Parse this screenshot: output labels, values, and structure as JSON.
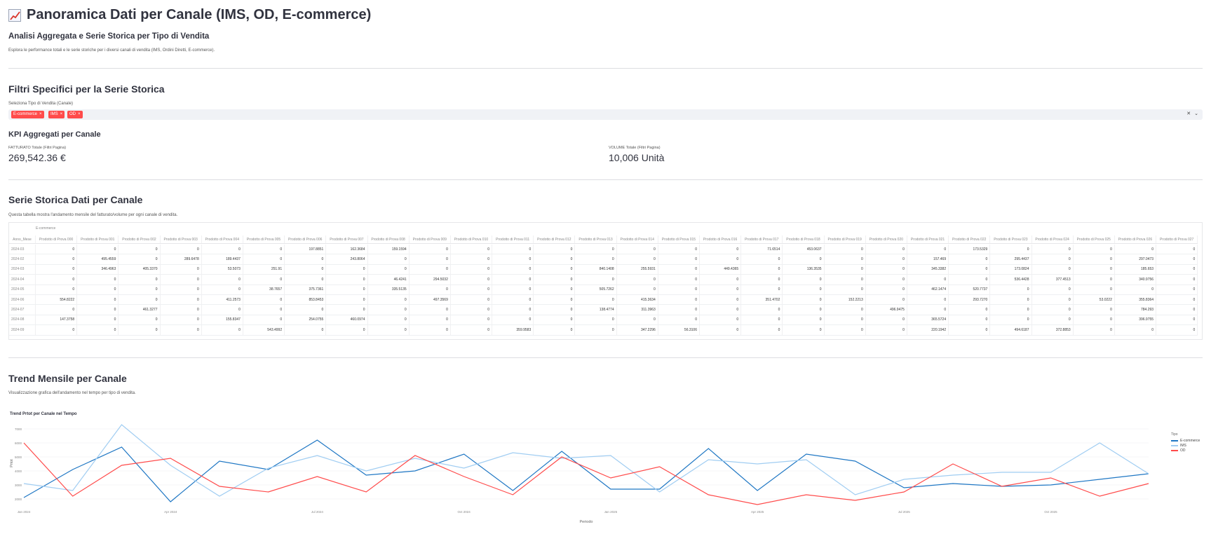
{
  "header": {
    "title": "Panoramica Dati per Canale (IMS, OD, E-commerce)",
    "subtitle": "Analisi Aggregata e Serie Storica per Tipo di Vendita",
    "caption": "Esplora le performance totali e le serie storiche per i diversi canali di vendita (IMS, Ordini Diretti, E-commerce)."
  },
  "filters": {
    "heading": "Filtri Specifici per la Serie Storica",
    "select_label": "Seleziona Tipo di Vendita (Canale)",
    "tags": [
      "E-commerce",
      "IMS",
      "OD"
    ],
    "tag_close_glyph": "×",
    "accent_color": "#ff4b4b"
  },
  "kpi": {
    "heading": "KPI Aggregati per Canale",
    "fatturato_label": "FATTURATO Totale (Filtri Pagina)",
    "fatturato_value": "269,542.36 €",
    "volume_label": "VOLUME Totale (Filtri Pagina)",
    "volume_value": "10,006 Unità"
  },
  "table_section": {
    "heading": "Serie Storica Dati per Canale",
    "caption": "Questa tabella mostra l'andamento mensile del fatturato/volume per ogni canale di vendita.",
    "group_label": "E-commerce",
    "index_header": "Anno_Mese",
    "columns": [
      "Prodotto di Prova 000",
      "Prodotto di Prova 001",
      "Prodotto di Prova 002",
      "Prodotto di Prova 003",
      "Prodotto di Prova 004",
      "Prodotto di Prova 005",
      "Prodotto di Prova 006",
      "Prodotto di Prova 007",
      "Prodotto di Prova 008",
      "Prodotto di Prova 009",
      "Prodotto di Prova 010",
      "Prodotto di Prova 011",
      "Prodotto di Prova 012",
      "Prodotto di Prova 013",
      "Prodotto di Prova 014",
      "Prodotto di Prova 015",
      "Prodotto di Prova 016",
      "Prodotto di Prova 017",
      "Prodotto di Prova 018",
      "Prodotto di Prova 019",
      "Prodotto di Prova 020",
      "Prodotto di Prova 021",
      "Prodotto di Prova 022",
      "Prodotto di Prova 023",
      "Prodotto di Prova 024",
      "Prodotto di Prova 025",
      "Prodotto di Prova 026",
      "Prodotto di Prova 027"
    ],
    "rows": [
      {
        "period": "2024-03",
        "values": [
          "0",
          "0",
          "0",
          "0",
          "0",
          "0",
          "197.8851",
          "162.3684",
          "159.1594",
          "0",
          "0",
          "0",
          "0",
          "0",
          "0",
          "0",
          "0",
          "71.6514",
          "453.0637",
          "0",
          "0",
          "0",
          "173.5329",
          "0",
          "0",
          "0",
          "0",
          "0"
        ]
      },
      {
        "period": "2024-02",
        "values": [
          "0",
          "495.4559",
          "0",
          "289.6478",
          "189.4437",
          "0",
          "0",
          "243.8064",
          "0",
          "0",
          "0",
          "0",
          "0",
          "0",
          "0",
          "0",
          "0",
          "0",
          "0",
          "0",
          "0",
          "157.469",
          "0",
          "295.4437",
          "0",
          "0",
          "297.0473",
          "0"
        ]
      },
      {
        "period": "2024-03",
        "values": [
          "0",
          "346.4963",
          "405.3370",
          "0",
          "53.5073",
          "251.91",
          "0",
          "0",
          "0",
          "0",
          "0",
          "0",
          "0",
          "840.1408",
          "255.5931",
          "0",
          "449.4365",
          "0",
          "136.3535",
          "0",
          "0",
          "345.3382",
          "0",
          "173.0824",
          "0",
          "0",
          "185.653",
          "0"
        ]
      },
      {
        "period": "2024-04",
        "values": [
          "0",
          "0",
          "0",
          "0",
          "0",
          "0",
          "0",
          "0",
          "46.4241",
          "294.5032",
          "0",
          "0",
          "0",
          "0",
          "0",
          "0",
          "0",
          "0",
          "0",
          "0",
          "0",
          "0",
          "0",
          "536.4428",
          "377.4513",
          "0",
          "340.9756",
          "0"
        ]
      },
      {
        "period": "2024-05",
        "values": [
          "0",
          "0",
          "0",
          "0",
          "0",
          "38.7657",
          "375.7361",
          "0",
          "335.5135",
          "0",
          "0",
          "0",
          "0",
          "505.7262",
          "0",
          "0",
          "0",
          "0",
          "0",
          "0",
          "0",
          "462.1474",
          "520.7737",
          "0",
          "0",
          "0",
          "0",
          "0"
        ]
      },
      {
        "period": "2024-06",
        "values": [
          "554.8222",
          "0",
          "0",
          "0",
          "411.2573",
          "0",
          "853.8453",
          "0",
          "0",
          "497.3569",
          "0",
          "0",
          "0",
          "0",
          "415.3634",
          "0",
          "0",
          "351.4702",
          "0",
          "152.2213",
          "0",
          "0",
          "293.7270",
          "0",
          "0",
          "53.0222",
          "355.8364",
          "0"
        ]
      },
      {
        "period": "2024-07",
        "values": [
          "0",
          "0",
          "461.3277",
          "0",
          "0",
          "0",
          "0",
          "0",
          "0",
          "0",
          "0",
          "0",
          "0",
          "138.4774",
          "311.3963",
          "0",
          "0",
          "0",
          "0",
          "0",
          "496.9475",
          "0",
          "0",
          "0",
          "0",
          "0",
          "784.293",
          "0"
        ]
      },
      {
        "period": "2024-08",
        "values": [
          "147.3758",
          "0",
          "0",
          "0",
          "155.8347",
          "0",
          "254.0755",
          "460.0974",
          "0",
          "0",
          "0",
          "0",
          "0",
          "0",
          "0",
          "0",
          "0",
          "0",
          "0",
          "0",
          "0",
          "365.5724",
          "0",
          "0",
          "0",
          "0",
          "396.9755",
          "0"
        ]
      },
      {
        "period": "2024-09",
        "values": [
          "0",
          "0",
          "0",
          "0",
          "0",
          "543.4992",
          "0",
          "0",
          "0",
          "0",
          "0",
          "359.9583",
          "0",
          "0",
          "347.2296",
          "56.3106",
          "0",
          "0",
          "0",
          "0",
          "0",
          "220.1942",
          "0",
          "494.6187",
          "372.8853",
          "0",
          "0",
          "0"
        ]
      }
    ]
  },
  "trend_section": {
    "heading": "Trend Mensile per Canale",
    "caption": "Visualizzazione grafica dell'andamento nel tempo per tipo di vendita."
  },
  "chart_data": {
    "type": "line",
    "title": "Trend Prtot per Canale nel Tempo",
    "xlabel": "Periodo",
    "ylabel": "Prtot",
    "legend_title": "Tipo",
    "legend_position": "top-right",
    "grid": true,
    "ylim": [
      1500,
      7600
    ],
    "yticks": [
      2000,
      3000,
      4000,
      5000,
      6000,
      7000
    ],
    "x": [
      "2024-01",
      "2024-02",
      "2024-03",
      "2024-04",
      "2024-05",
      "2024-06",
      "2024-07",
      "2024-08",
      "2024-09",
      "2024-10",
      "2024-11",
      "2024-12",
      "2025-01",
      "2025-02",
      "2025-03",
      "2025-04",
      "2025-05",
      "2025-06",
      "2025-07",
      "2025-08",
      "2025-09",
      "2025-10",
      "2025-11",
      "2025-12"
    ],
    "xtick_labels": [
      {
        "x": "2024-01",
        "label": "Jan 2024"
      },
      {
        "x": "2024-04",
        "label": "Apr 2024"
      },
      {
        "x": "2024-07",
        "label": "Jul 2024"
      },
      {
        "x": "2024-10",
        "label": "Oct 2024"
      },
      {
        "x": "2025-01",
        "label": "Jan 2025"
      },
      {
        "x": "2025-04",
        "label": "Apr 2025"
      },
      {
        "x": "2025-07",
        "label": "Jul 2025"
      },
      {
        "x": "2025-10",
        "label": "Oct 2025"
      }
    ],
    "series": [
      {
        "name": "E-commerce",
        "color": "#1f77c4",
        "values": [
          2100,
          4100,
          5700,
          1800,
          4700,
          4100,
          6200,
          3700,
          4000,
          5200,
          2600,
          5400,
          2700,
          2700,
          5600,
          2600,
          5200,
          4700,
          2800,
          3100,
          2900,
          3000,
          3400,
          3800
        ]
      },
      {
        "name": "IMS",
        "color": "#a0cdf2",
        "values": [
          3100,
          2600,
          7300,
          4400,
          2200,
          4200,
          5100,
          4000,
          4900,
          4200,
          5300,
          4900,
          5100,
          2500,
          4800,
          4500,
          4800,
          2300,
          3400,
          3700,
          3900,
          3900,
          6000,
          3800
        ]
      },
      {
        "name": "OD",
        "color": "#ff4b4b",
        "values": [
          6000,
          2200,
          4400,
          4900,
          2900,
          2500,
          3600,
          2500,
          5100,
          3600,
          2300,
          5000,
          3500,
          4300,
          2300,
          1600,
          2300,
          1900,
          2500,
          4500,
          2900,
          3500,
          2200,
          3100
        ]
      }
    ]
  }
}
